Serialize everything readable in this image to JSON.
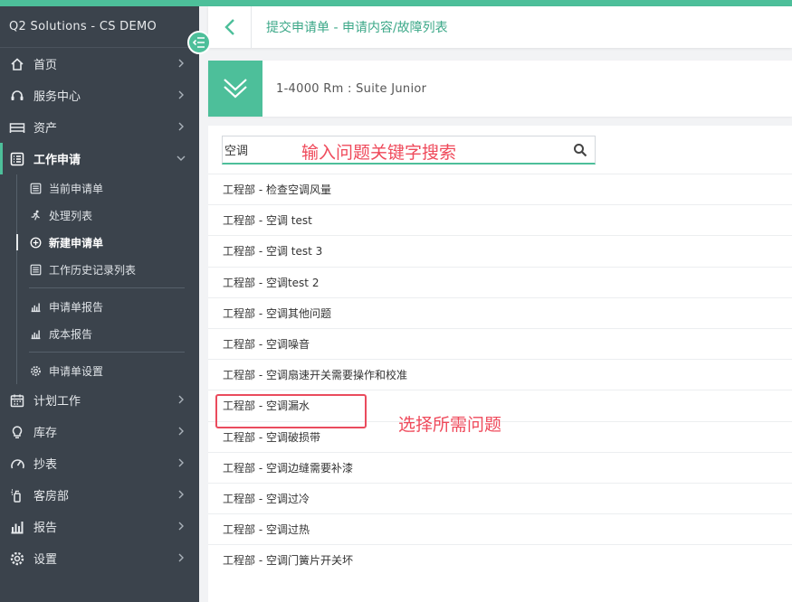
{
  "app": {
    "title": "Q2 Solutions - CS DEMO"
  },
  "colors": {
    "accent": "#4dbf9a",
    "sidebar": "#3b434c",
    "annotation": "#ef4a5b"
  },
  "sidebar": {
    "items": [
      {
        "label": "首页",
        "icon": "home-icon"
      },
      {
        "label": "服务中心",
        "icon": "headset-icon"
      },
      {
        "label": "资产",
        "icon": "bed-icon"
      },
      {
        "label": "工作申请",
        "icon": "list-icon",
        "expanded": true
      },
      {
        "label": "计划工作",
        "icon": "calendar-icon"
      },
      {
        "label": "库存",
        "icon": "bulb-icon"
      },
      {
        "label": "抄表",
        "icon": "gauge-icon"
      },
      {
        "label": "客房部",
        "icon": "spray-icon"
      },
      {
        "label": "报告",
        "icon": "bar-chart-icon"
      },
      {
        "label": "设置",
        "icon": "gear-icon"
      }
    ],
    "sub_items": [
      {
        "label": "当前申请单",
        "icon": "list-icon"
      },
      {
        "label": "处理列表",
        "icon": "running-icon"
      },
      {
        "label": "新建申请单",
        "icon": "plus-circle-icon"
      },
      {
        "label": "工作历史记录列表",
        "icon": "list-icon"
      },
      {
        "label": "申请单报告",
        "icon": "bar-chart-icon"
      },
      {
        "label": "成本报告",
        "icon": "bar-chart-icon"
      },
      {
        "label": "申请单设置",
        "icon": "gear-icon"
      }
    ]
  },
  "header": {
    "breadcrumb": "提交申请单 - 申请内容/故障列表"
  },
  "room": {
    "label": "1-4000 Rm : Suite Junior"
  },
  "search": {
    "value": "空调"
  },
  "annotations": {
    "search_hint": "输入问题关键字搜索",
    "select_hint": "选择所需问题"
  },
  "issues": [
    "工程部 - 检查空调风量",
    "工程部 - 空调 test",
    "工程部 - 空调 test 3",
    "工程部 - 空调test 2",
    "工程部 - 空调其他问题",
    "工程部 - 空调噪音",
    "工程部 - 空调扇速开关需要操作和校准",
    "工程部 - 空调漏水",
    "工程部 - 空调破损带",
    "工程部 - 空调边缝需要补漆",
    "工程部 - 空调过冷",
    "工程部 - 空调过热",
    "工程部 - 空调门簧片开关坏"
  ]
}
